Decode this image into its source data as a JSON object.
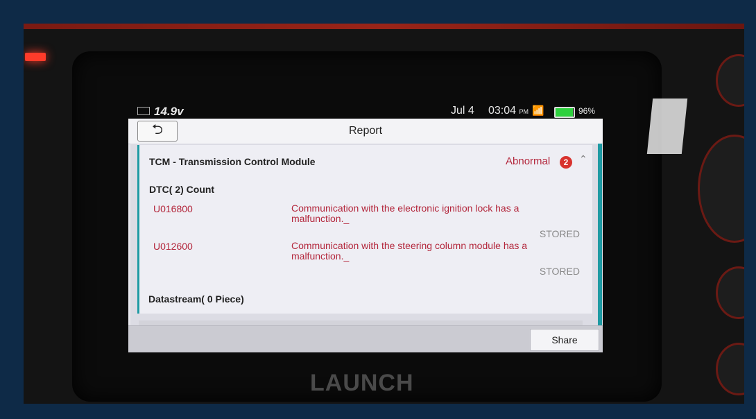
{
  "device": {
    "brand": "LAUNCH"
  },
  "status_bar": {
    "voltage": "14.9v",
    "date": "Jul 4",
    "time": "03:04",
    "ampm": "PM",
    "battery_percent": "96%",
    "battery_level": 0.96
  },
  "app": {
    "title": "Report",
    "back_icon": "back-arrow-icon",
    "module": {
      "name": "TCM - Transmission Control Module",
      "status": "Abnormal",
      "count": "2"
    },
    "dtc_header": "DTC( 2) Count",
    "dtcs": [
      {
        "code": "U016800",
        "description": "Communication with the electronic ignition lock has a malfunction._",
        "state": "STORED"
      },
      {
        "code": "U012600",
        "description": "Communication with the steering column module has a malfunction._",
        "state": "STORED"
      }
    ],
    "datastream_header": "Datastream( 0 Piece)",
    "share_label": "Share"
  },
  "colors": {
    "accent": "#1e9aa3",
    "error": "#b3263b"
  }
}
